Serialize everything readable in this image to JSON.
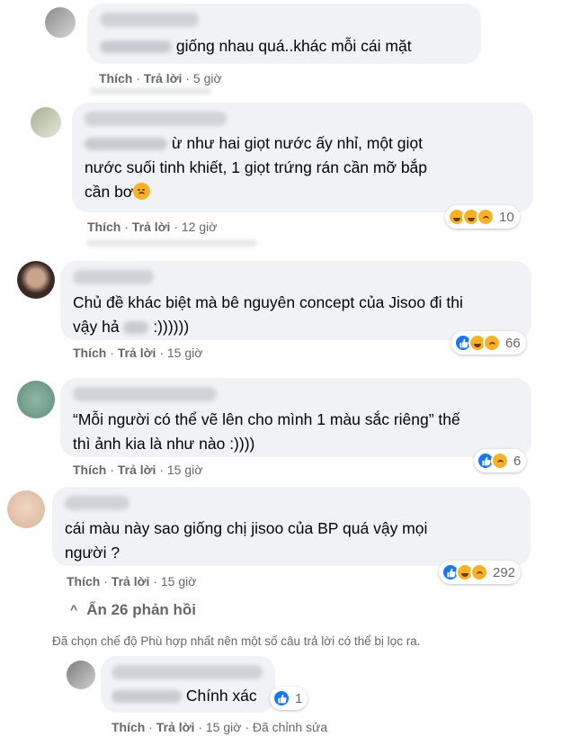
{
  "comments": [
    {
      "text_visible": "giống nhau quá..khác mỗi cái mặt",
      "like_label": "Thích",
      "reply_label": "Trả lời",
      "sep": "·",
      "time": "5 giờ"
    },
    {
      "text_line1": "ừ như hai giọt nước ấy nhỉ, một giọt",
      "text_line2": "nước suối tinh khiết, 1 giọt trứng rán cần mỡ bắp",
      "text_line3": "cần bơ",
      "like_label": "Thích",
      "reply_label": "Trả lời",
      "sep": "·",
      "time": "12 giờ",
      "reaction_count": "10",
      "reactions": [
        "haha-icon",
        "sad-icon"
      ]
    },
    {
      "text_line1": "Chủ đề khác biệt mà bê nguyên concept của Jisoo đi thi",
      "text_line2a": "vậy hả",
      "text_line2b": ":))))))",
      "like_label": "Thích",
      "reply_label": "Trả lời",
      "sep": "·",
      "time": "15 giờ",
      "reaction_count": "66",
      "reactions": [
        "like-icon",
        "haha-icon",
        "sad-icon"
      ]
    },
    {
      "text_line1": "“Mỗi người có thể vẽ lên cho mình 1 màu sắc riêng” thế",
      "text_line2": "thì ảnh kia là như nào :))))",
      "like_label": "Thích",
      "reply_label": "Trả lời",
      "sep": "·",
      "time": "15 giờ",
      "reaction_count": "6",
      "reactions": [
        "like-icon",
        "sad-icon"
      ]
    },
    {
      "text_line1": "cái màu này sao giống chị jisoo của BP quá vậy mọi",
      "text_line2": "người ?",
      "like_label": "Thích",
      "reply_label": "Trả lời",
      "sep": "·",
      "time": "15 giờ",
      "reaction_count": "292",
      "reactions": [
        "like-icon",
        "haha-icon",
        "sad-icon"
      ]
    }
  ],
  "hide_replies": {
    "chevron": "^",
    "label": "Ẩn 26 phản hồi"
  },
  "notice": "Đã chọn chế độ Phù hợp nhất nên một số câu trả lời có thể bị lọc ra.",
  "reply": {
    "text": "Chính xác",
    "like_label": "Thích",
    "reply_label": "Trả lời",
    "sep": "·",
    "time": "15 giờ",
    "edited": "Đã chỉnh sửa",
    "reaction_count": "1",
    "reactions": [
      "like-icon"
    ]
  },
  "colors": {
    "bubble": "#f0f2f5",
    "meta": "#65676b",
    "like_blue": "#1877f2",
    "emoji_yellow": "#f7b125"
  }
}
